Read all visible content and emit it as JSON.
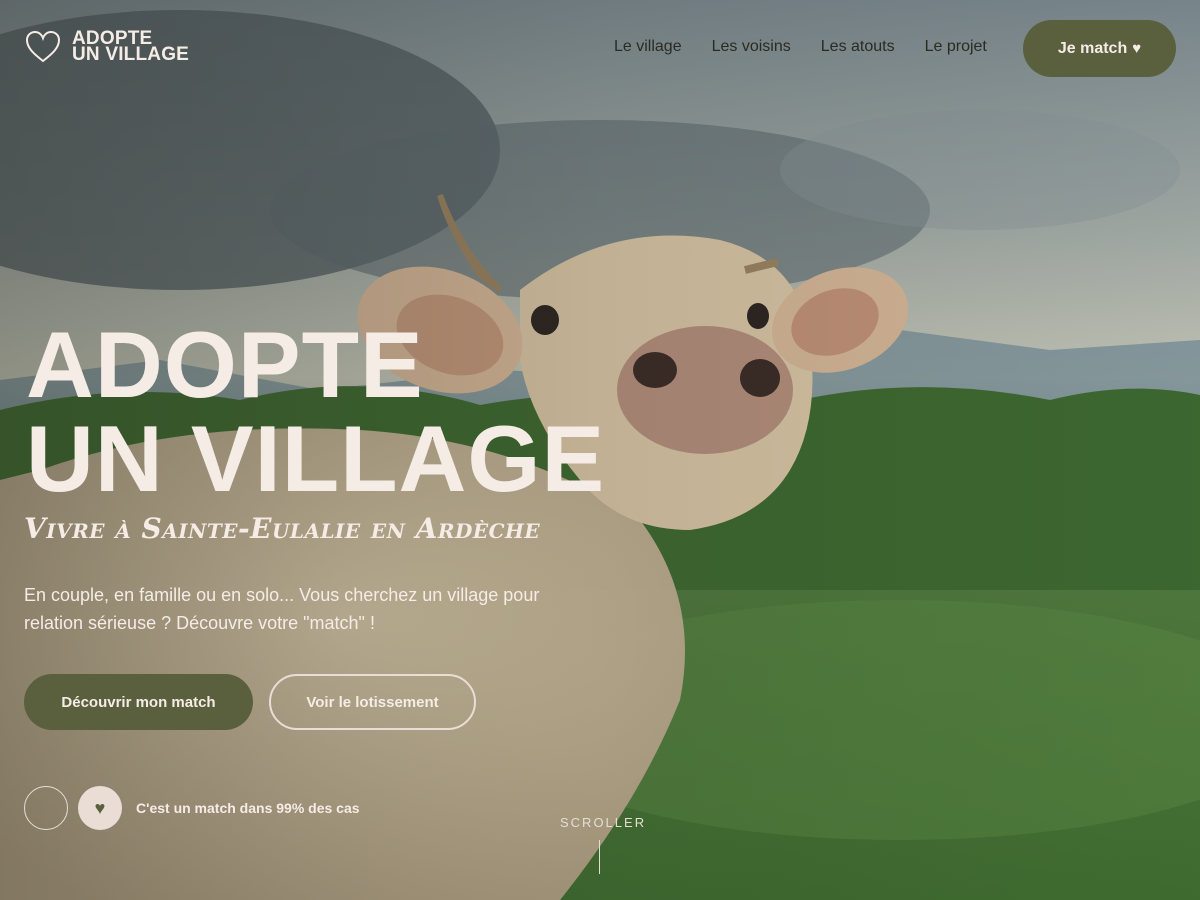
{
  "brand": {
    "line1": "ADOPTE",
    "line2": "UN VILLAGE"
  },
  "nav": {
    "items": [
      {
        "label": "Le village"
      },
      {
        "label": "Les voisins"
      },
      {
        "label": "Les atouts"
      },
      {
        "label": "Le projet"
      }
    ],
    "cta_label": "Je match"
  },
  "hero": {
    "title_line1": "ADOPTE",
    "title_line2": "UN VILLAGE",
    "subtitle": "Vivre à Sainte-Eulalie en Ardèche",
    "description": "En couple, en famille ou en solo... Vous cherchez un village pour relation sérieuse ? Découvre votre \"match\" !",
    "primary_button": "Découvrir mon match",
    "secondary_button": "Voir le lotissement",
    "match_stat": "C'est un match dans 99% des cas",
    "scroll_label": "SCROLLER"
  },
  "colors": {
    "accent": "#5a603d",
    "cream": "#f6ece6",
    "nav_text": "#2b2b22"
  },
  "icons": {
    "logo": "heart-outline-icon",
    "cta": "heart-icon",
    "stat": "heart-icon"
  }
}
